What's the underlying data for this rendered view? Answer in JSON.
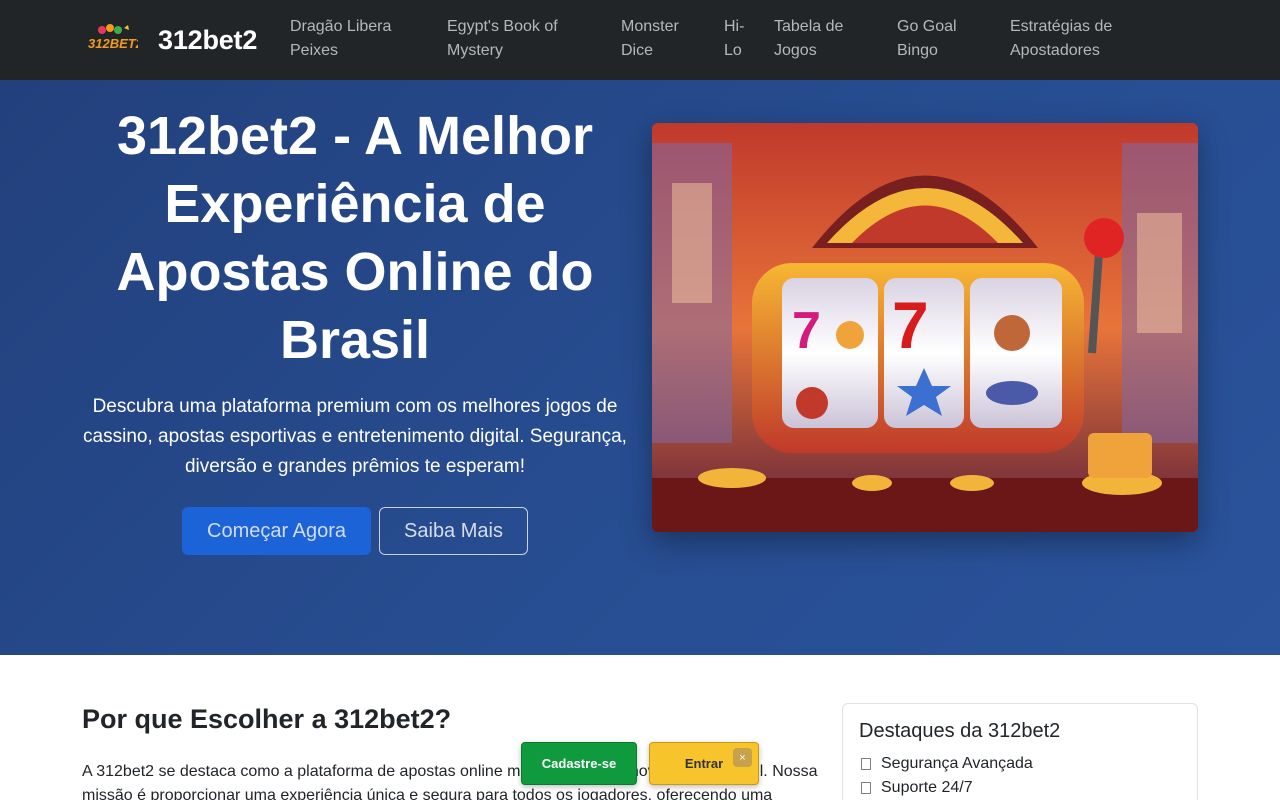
{
  "navbar": {
    "brand_name": "312bet2",
    "logo_text": "312BET2",
    "links": [
      {
        "label": "Dragão Libera Peixes"
      },
      {
        "label": "Egypt's Book of Mystery"
      },
      {
        "label": "Monster Dice"
      },
      {
        "label": "Hi-Lo"
      },
      {
        "label": "Tabela de Jogos"
      },
      {
        "label": "Go Goal Bingo"
      },
      {
        "label": "Estratégias de Apostadores"
      }
    ]
  },
  "hero": {
    "title": "312bet2 - A Melhor Experiência de Apostas Online do Brasil",
    "description": "Descubra uma plataforma premium com os melhores jogos de cassino, apostas esportivas e entretenimento digital. Segurança, diversão e grandes prêmios te esperam!",
    "primary_button": "Começar Agora",
    "secondary_button": "Saiba Mais"
  },
  "about": {
    "title": "Por que Escolher a 312bet2?",
    "text": "A 312bet2 se destaca como a plataforma de apostas online mais confiável e inovadora do Brasil. Nossa missão é proporcionar uma experiência única e segura para todos os jogadores, oferecendo uma"
  },
  "highlights": {
    "title": "Destaques da 312bet2",
    "items": [
      {
        "label": "Segurança Avançada"
      },
      {
        "label": "Suporte 24/7"
      }
    ]
  },
  "floating_bar": {
    "register": "Cadastre-se",
    "login": "Entrar",
    "close": "×"
  },
  "colors": {
    "navbar_bg": "#222528",
    "hero_bg": "#274d91",
    "primary_button": "#1d63d8",
    "register_button": "#0f9a3d",
    "login_button": "#f7c52b"
  }
}
